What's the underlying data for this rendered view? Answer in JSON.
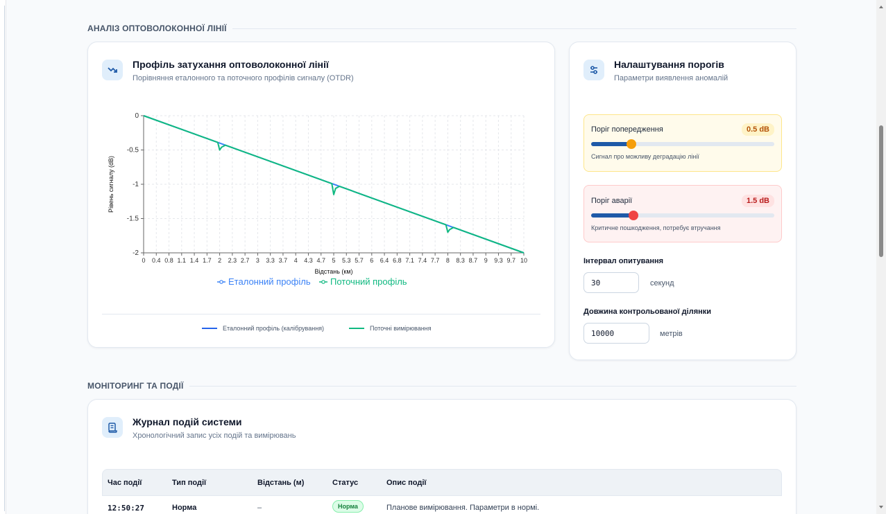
{
  "sections": {
    "analysis": "АНАЛІЗ ОПТОВОЛОКОННОЇ ЛІНІЇ",
    "monitoring": "МОНІТОРИНГ ТА ПОДІЇ"
  },
  "profile_card": {
    "title": "Профіль затухання оптоволоконної лінії",
    "subtitle": "Порівняння еталонного та поточного профілів сигналу (OTDR)",
    "icon": "trend-down-icon",
    "bottom_legend": [
      {
        "label": "Еталонний профіль (калібрування)",
        "color": "#2563eb"
      },
      {
        "label": "Поточні вимірювання",
        "color": "#10b981"
      }
    ]
  },
  "chart_data": {
    "type": "line",
    "xlabel": "Відстань (км)",
    "ylabel": "Рівень сигналу (dB)",
    "xlim": [
      0,
      10
    ],
    "ylim": [
      -2,
      0
    ],
    "x_ticks": [
      "0",
      "0.4",
      "0.8",
      "1.1",
      "1.4",
      "1.7",
      "2",
      "2.3",
      "2.7",
      "3",
      "3.3",
      "3.7",
      "4",
      "4.3",
      "4.7",
      "5",
      "5.3",
      "5.7",
      "6",
      "6.4",
      "6.8",
      "7.1",
      "7.4",
      "7.7",
      "8",
      "8.3",
      "8.7",
      "9",
      "9.3",
      "9.7",
      "10"
    ],
    "y_ticks": [
      "0",
      "-0.5",
      "-1",
      "-1.5",
      "-2"
    ],
    "grid": true,
    "legend_position": "bottom",
    "series": [
      {
        "name": "Еталонний профіль",
        "color": "#3b82f6",
        "x": [
          0,
          10
        ],
        "y": [
          0,
          -2
        ]
      },
      {
        "name": "Поточний профіль",
        "color": "#10b981",
        "x": [
          0,
          1.95,
          2.0,
          2.05,
          2.15,
          4.95,
          5.0,
          5.05,
          5.15,
          7.95,
          8.0,
          8.05,
          8.15,
          10
        ],
        "y": [
          0,
          -0.39,
          -0.5,
          -0.46,
          -0.43,
          -0.99,
          -1.15,
          -1.06,
          -1.03,
          -1.59,
          -1.7,
          -1.66,
          -1.63,
          -2.0
        ]
      }
    ]
  },
  "thresholds_card": {
    "title": "Налаштування порогів",
    "subtitle": "Параметри виявлення аномалій",
    "icon": "sliders-icon",
    "warning": {
      "label": "Поріг попередження",
      "value_label": "0.5 dB",
      "fraction": 0.22,
      "hint": "Сигнал про можливу деградацію лінії",
      "bg": "#fffbeb",
      "border": "#fde68a",
      "badge_bg": "#fef3c7",
      "badge_fg": "#b45309",
      "knob": "#f59e0b"
    },
    "alarm": {
      "label": "Поріг аварії",
      "value_label": "1.5 dB",
      "fraction": 0.23,
      "hint": "Критичне пошкодження, потребує втручання",
      "bg": "#fef2f2",
      "border": "#fecaca",
      "badge_bg": "#fee2e2",
      "badge_fg": "#b91c1c",
      "knob": "#ef4444"
    },
    "interval": {
      "label": "Інтервал опитування",
      "value": "30",
      "unit": "секунд"
    },
    "length": {
      "label": "Довжина контрольованої ділянки",
      "value": "10000",
      "unit": "метрів"
    }
  },
  "events_card": {
    "title": "Журнал подій системи",
    "subtitle": "Хронологічний запис усіх подій та вимірювань",
    "icon": "scroll-icon",
    "columns": [
      "Час події",
      "Тип події",
      "Відстань (м)",
      "Статус",
      "Опис події"
    ],
    "rows": [
      {
        "time": "12:50:27",
        "type": "Норма",
        "distance": "–",
        "status": "Норма",
        "description": "Планове вимірювання. Параметри в нормі."
      }
    ]
  }
}
